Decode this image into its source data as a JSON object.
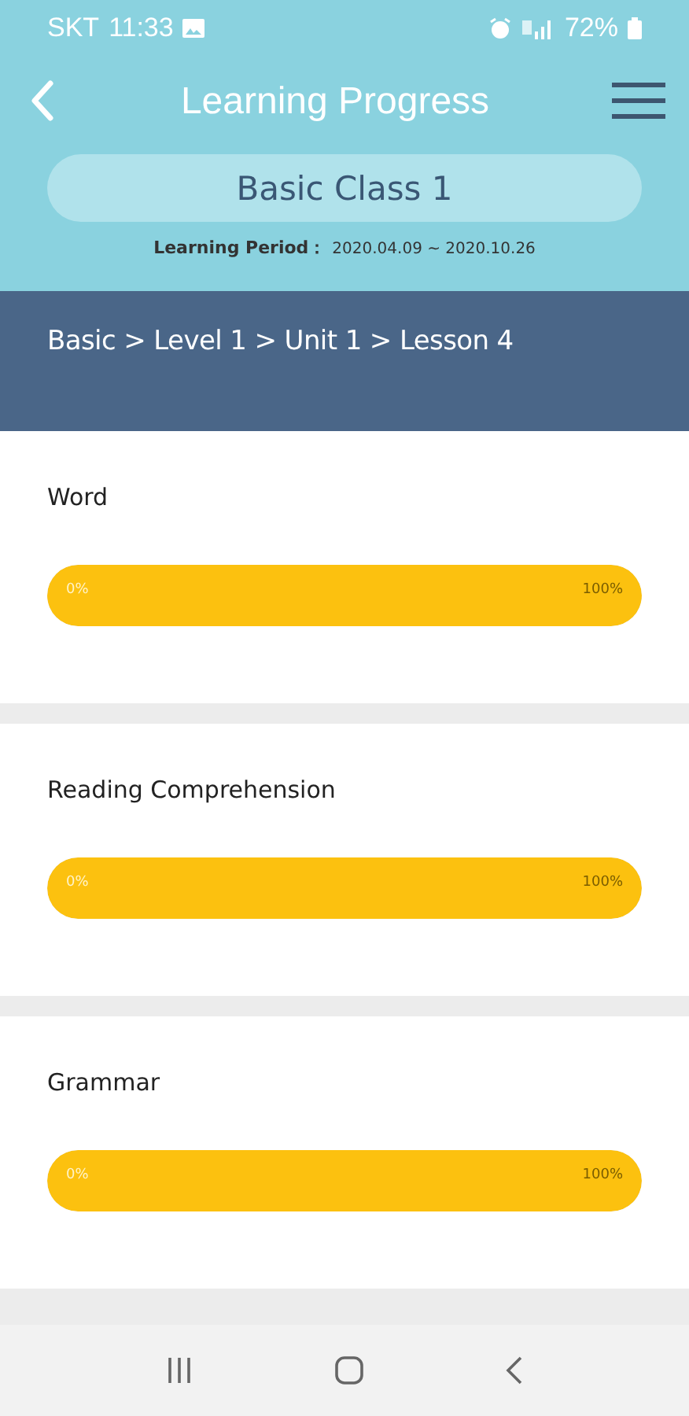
{
  "status_bar": {
    "carrier": "SKT",
    "time": "11:33",
    "battery": "72%"
  },
  "header": {
    "title": "Learning Progress",
    "class_name": "Basic Class 1",
    "period_label": "Learning Period：",
    "period": "2020.04.09 ~ 2020.10.26"
  },
  "breadcrumb": "Basic > Level 1 > Unit 1 > Lesson 4",
  "sections": [
    {
      "title": "Word",
      "level": 1,
      "start_label": "0%",
      "end_label": "100%"
    },
    {
      "title": "Reading Comprehension",
      "level": 1,
      "start_label": "0%",
      "end_label": "100%"
    },
    {
      "title": "Grammar",
      "level": 1,
      "start_label": "0%",
      "end_label": "100%"
    }
  ]
}
